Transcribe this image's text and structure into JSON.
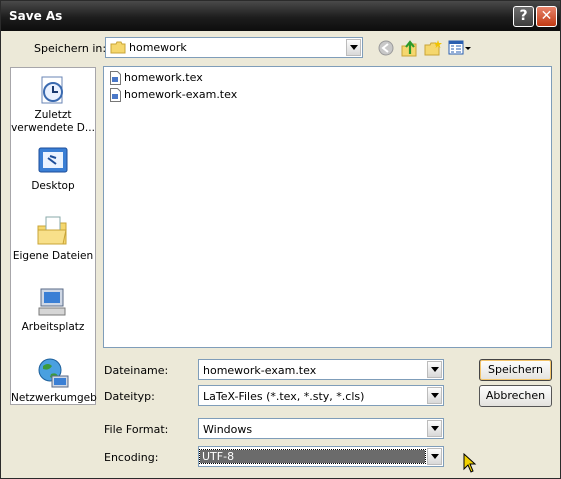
{
  "window": {
    "title": "Save As",
    "help_glyph": "?",
    "close_glyph": "✕"
  },
  "lookin": {
    "label": "Speichern in:",
    "value": "homework"
  },
  "places": [
    {
      "label": "Zuletzt verwendete D...",
      "icon": "recent-documents-icon"
    },
    {
      "label": "Desktop",
      "icon": "desktop-icon"
    },
    {
      "label": "Eigene Dateien",
      "icon": "my-documents-icon"
    },
    {
      "label": "Arbeitsplatz",
      "icon": "my-computer-icon"
    },
    {
      "label": "Netzwerkumgeb",
      "icon": "network-places-icon"
    }
  ],
  "files": [
    "homework.tex",
    "homework-exam.tex"
  ],
  "form": {
    "filename_label": "Dateiname:",
    "filename_value": "homework-exam.tex",
    "filetype_label": "Dateityp:",
    "filetype_value": "LaTeX-Files (*.tex, *.sty, *.cls)",
    "format_label": "File Format:",
    "format_value": "Windows",
    "encoding_label": "Encoding:",
    "encoding_value": "UTF-8"
  },
  "buttons": {
    "save": "Speichern",
    "cancel": "Abbrechen"
  }
}
